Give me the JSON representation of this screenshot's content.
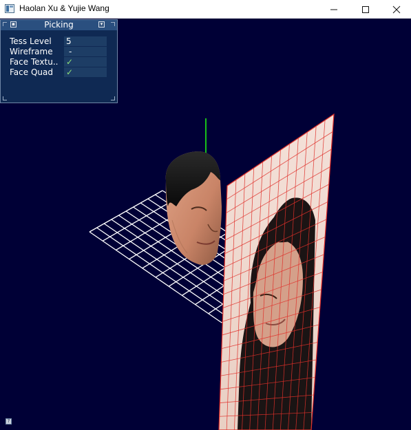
{
  "window": {
    "title": "Haolan Xu & Yujie Wang",
    "icon": "app-window-icon",
    "buttons": [
      "minimize-icon",
      "maximize-icon",
      "close-icon"
    ]
  },
  "tweakbar": {
    "title": "Picking",
    "rows": [
      {
        "label": "Tess Level",
        "value": "5"
      },
      {
        "label": "Wireframe",
        "value": "-"
      },
      {
        "label": "Face Textu..",
        "value": "✓"
      },
      {
        "label": "Face Quad",
        "value": "✓"
      }
    ],
    "help": "?"
  },
  "scene": {
    "background": "#000036",
    "grid_color": "#ffffff",
    "axis_color": "#19c019",
    "quad_grid_color": "#e0302a"
  }
}
